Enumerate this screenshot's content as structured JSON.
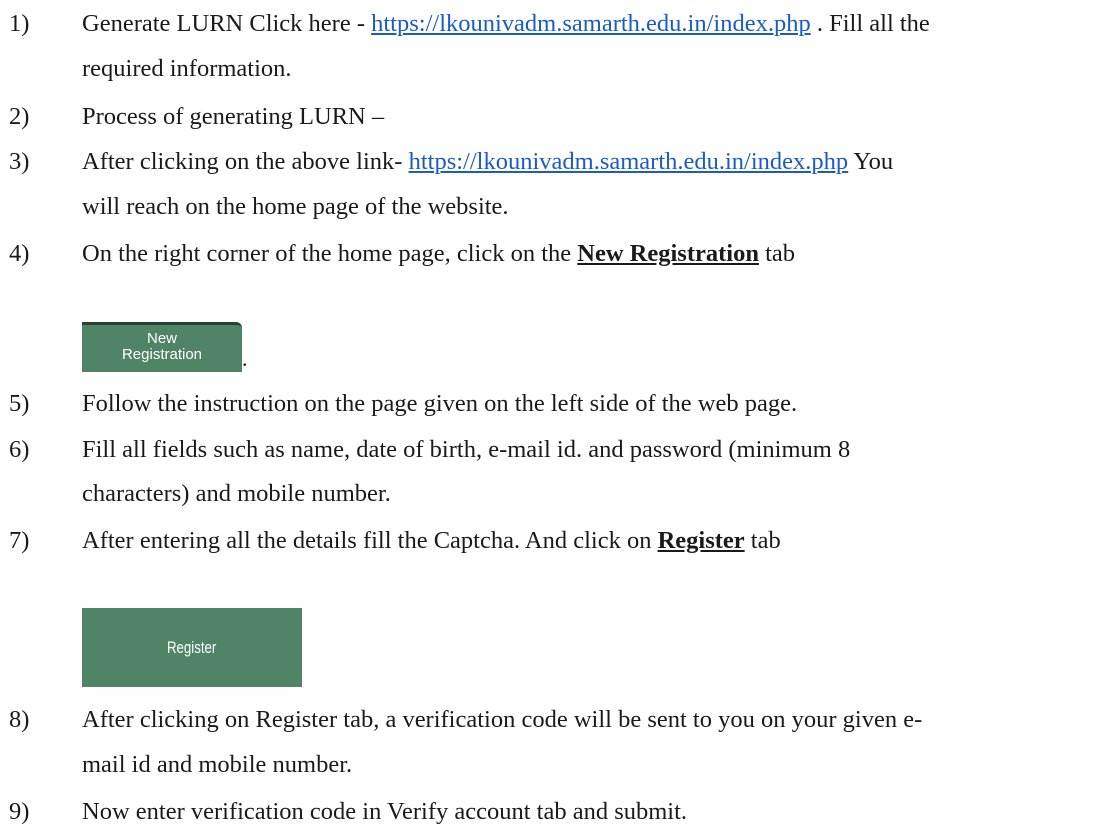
{
  "items": [
    {
      "num": "1)",
      "pre": "Generate LURN Click here - ",
      "link": "https://lkounivadm.samarth.edu.in/index.php",
      "post": " . Fill all the",
      "line2": "required information."
    },
    {
      "num": "2)",
      "text": "Process of generating LURN –"
    },
    {
      "num": "3)",
      "pre": "After clicking on the above link- ",
      "link": "https://lkounivadm.samarth.edu.in/index.php",
      "post": "  You",
      "line2": "will reach on the home page of the website."
    },
    {
      "num": "4)",
      "pre": "On the right corner of the home page, click on the ",
      "bold": "New Registration",
      "post": " tab"
    },
    {
      "num": "5)",
      "text": "Follow the instruction on the page given on the left side of the web page."
    },
    {
      "num": "6)",
      "text": "Fill all fields such as name, date of birth, e-mail id. and password (minimum 8",
      "line2": "characters) and mobile number."
    },
    {
      "num": "7)",
      "pre": "After entering all the details fill the Captcha. And click on ",
      "bold": "Register",
      "post": " tab"
    },
    {
      "num": "8)",
      "text": "After clicking on Register tab, a verification code will be sent to you on your given e-",
      "line2": "mail id and mobile number."
    },
    {
      "num": "9)",
      "text": "Now enter verification code in Verify account tab and submit."
    }
  ],
  "new_registration_button": {
    "line1": "New",
    "line2": "Registration"
  },
  "trailing_dot": ".",
  "register_button": {
    "label": "Register"
  },
  "colors": {
    "link": "#1a5bc8",
    "button_green": "#4f8467"
  }
}
